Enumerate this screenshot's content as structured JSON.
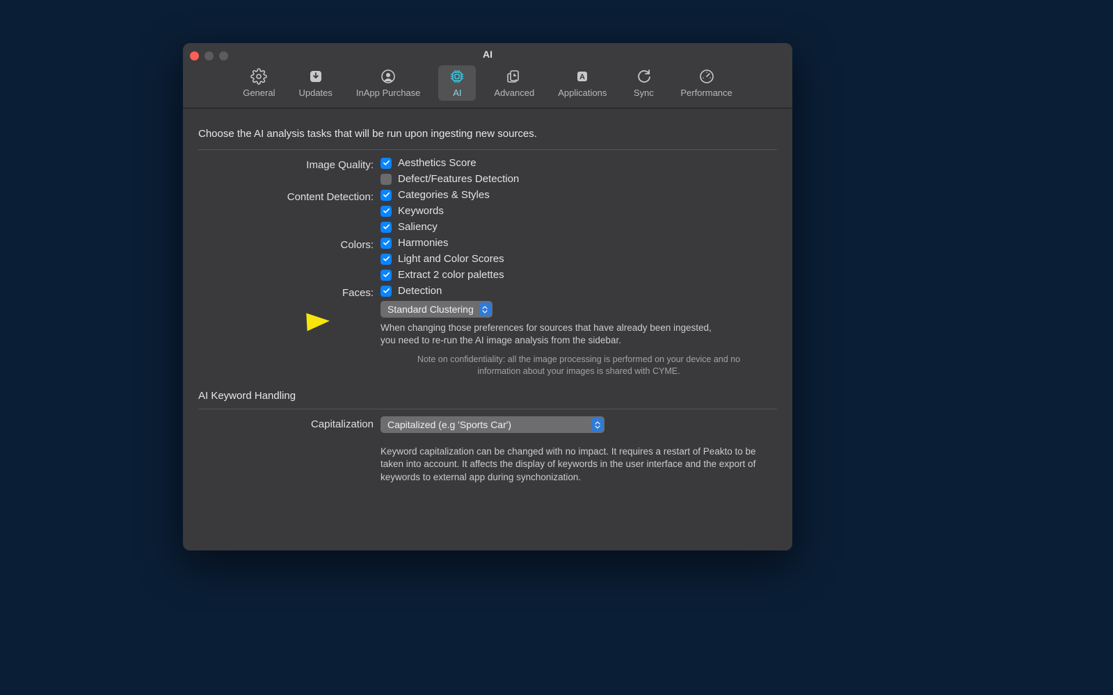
{
  "window": {
    "title": "AI"
  },
  "toolbar": {
    "items": [
      {
        "label": "General"
      },
      {
        "label": "Updates"
      },
      {
        "label": "InApp Purchase"
      },
      {
        "label": "AI"
      },
      {
        "label": "Advanced"
      },
      {
        "label": "Applications"
      },
      {
        "label": "Sync"
      },
      {
        "label": "Performance"
      }
    ],
    "active_index": 3
  },
  "section1": {
    "intro": "Choose the AI analysis tasks that will be run upon ingesting new sources.",
    "groups": {
      "image_quality": {
        "label": "Image Quality:",
        "options": [
          {
            "label": "Aesthetics Score",
            "checked": true
          },
          {
            "label": "Defect/Features Detection",
            "checked": false
          }
        ]
      },
      "content_detection": {
        "label": "Content Detection:",
        "options": [
          {
            "label": "Categories & Styles",
            "checked": true
          },
          {
            "label": "Keywords",
            "checked": true
          },
          {
            "label": "Saliency",
            "checked": true
          }
        ]
      },
      "colors": {
        "label": "Colors:",
        "options": [
          {
            "label": "Harmonies",
            "checked": true
          },
          {
            "label": "Light and Color Scores",
            "checked": true
          },
          {
            "label": "Extract 2 color palettes",
            "checked": true
          }
        ]
      },
      "faces": {
        "label": "Faces:",
        "options": [
          {
            "label": "Detection",
            "checked": true
          }
        ],
        "clustering_select": "Standard Clustering"
      }
    },
    "note_primary": "When changing those preferences for sources that have already been ingested, you need to re-run the AI image analysis from the sidebar.",
    "note_confidentiality": "Note on confidentiality: all the image processing is performed on your device and no information about your images is shared with CYME."
  },
  "section2": {
    "title": "AI Keyword Handling",
    "capitalization": {
      "label": "Capitalization",
      "value": "Capitalized (e.g 'Sports Car')"
    },
    "note": "Keyword capitalization can be changed with no impact. It requires a restart of Peakto to be taken into account. It affects the display of keywords in the user interface and the export of keywords to external app during synchonization."
  }
}
